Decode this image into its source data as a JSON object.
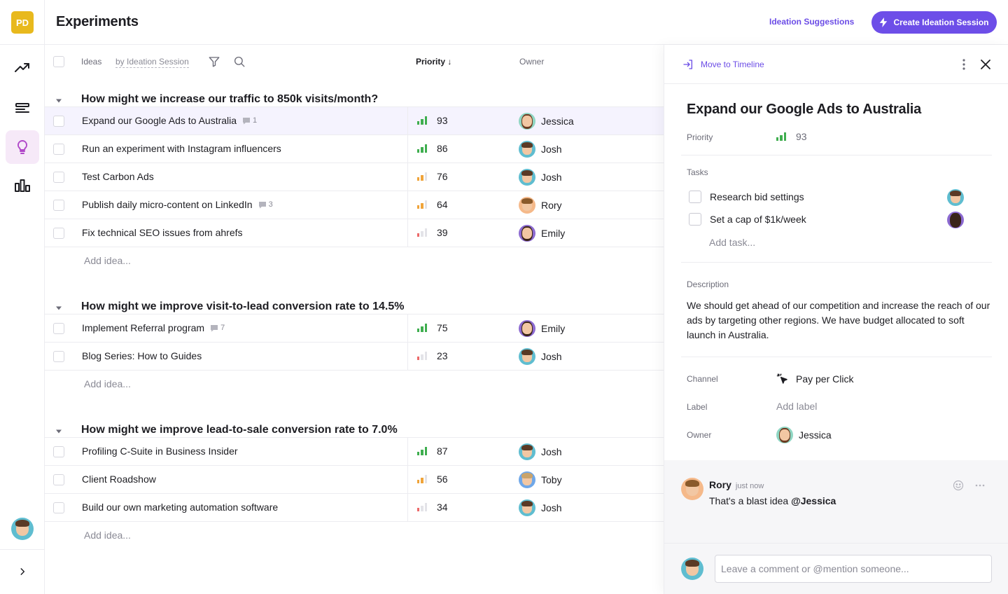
{
  "workspace": {
    "initials": "PD"
  },
  "header": {
    "title": "Experiments",
    "ideation_link": "Ideation Suggestions",
    "create_button": "Create Ideation Session"
  },
  "table": {
    "headers": {
      "ideas": "Ideas",
      "group_by": "by Ideation Session",
      "priority": "Priority ↓",
      "owner": "Owner"
    },
    "add_idea_label": "Add idea...",
    "groups": [
      {
        "title": "How might we increase our traffic to 850k visits/month?",
        "rows": [
          {
            "idea": "Expand our Google Ads to Australia",
            "comments": "1",
            "priority": "93",
            "level": "high",
            "owner": "Jessica"
          },
          {
            "idea": "Run an experiment with Instagram influencers",
            "comments": "",
            "priority": "86",
            "level": "high",
            "owner": "Josh"
          },
          {
            "idea": "Test Carbon Ads",
            "comments": "",
            "priority": "76",
            "level": "mid",
            "owner": "Josh"
          },
          {
            "idea": "Publish daily micro-content on LinkedIn",
            "comments": "3",
            "priority": "64",
            "level": "mid",
            "owner": "Rory"
          },
          {
            "idea": "Fix technical SEO issues from ahrefs",
            "comments": "",
            "priority": "39",
            "level": "low",
            "owner": "Emily"
          }
        ]
      },
      {
        "title": "How might we improve visit-to-lead conversion rate to 14.5%",
        "rows": [
          {
            "idea": "Implement Referral program",
            "comments": "7",
            "priority": "75",
            "level": "high",
            "owner": "Emily"
          },
          {
            "idea": "Blog Series: How to Guides",
            "comments": "",
            "priority": "23",
            "level": "low",
            "owner": "Josh"
          }
        ]
      },
      {
        "title": "How might we improve lead-to-sale conversion rate to 7.0%",
        "rows": [
          {
            "idea": "Profiling C-Suite in Business Insider",
            "comments": "",
            "priority": "87",
            "level": "high",
            "owner": "Josh"
          },
          {
            "idea": "Client Roadshow",
            "comments": "",
            "priority": "56",
            "level": "mid",
            "owner": "Toby"
          },
          {
            "idea": "Build our own marketing automation software",
            "comments": "",
            "priority": "34",
            "level": "low",
            "owner": "Josh"
          }
        ]
      }
    ]
  },
  "panel": {
    "move_link": "Move to Timeline",
    "title": "Expand our Google Ads to Australia",
    "priority_label": "Priority",
    "priority_value": "93",
    "tasks_label": "Tasks",
    "tasks": [
      {
        "label": "Research bid settings",
        "assignee": "Josh"
      },
      {
        "label": "Set a cap of $1k/week",
        "assignee": "Emily"
      }
    ],
    "add_task": "Add task...",
    "description_label": "Description",
    "description": "We should get ahead of our competition and increase the reach of our ads by targeting other regions. We have budget allocated to soft launch in Australia.",
    "channel_label": "Channel",
    "channel_value": "Pay per Click",
    "label_label": "Label",
    "label_value": "Add label",
    "owner_label": "Owner",
    "owner_value": "Jessica"
  },
  "comments": {
    "items": [
      {
        "author": "Rory",
        "time": "just now",
        "text": "That's a blast idea ",
        "mention": "@Jessica"
      }
    ],
    "input_placeholder": "Leave a comment or @mention someone..."
  },
  "colors": {
    "accent": "#6d4ee8",
    "logo": "#e8b91d",
    "priority_high": "#3fae4f",
    "priority_mid": "#f0a43a",
    "priority_low": "#ec6a6a",
    "bar_empty": "#e3e3e8"
  },
  "icons": [
    "trend-icon",
    "roadmap-icon",
    "lightbulb-icon",
    "bar-chart-icon",
    "filter-icon",
    "search-icon",
    "comment-icon",
    "caret-down-icon",
    "move-icon",
    "kebab-icon",
    "close-icon",
    "cursor-click-icon",
    "emoji-icon",
    "more-icon",
    "chevron-right-icon",
    "bolt-icon"
  ]
}
